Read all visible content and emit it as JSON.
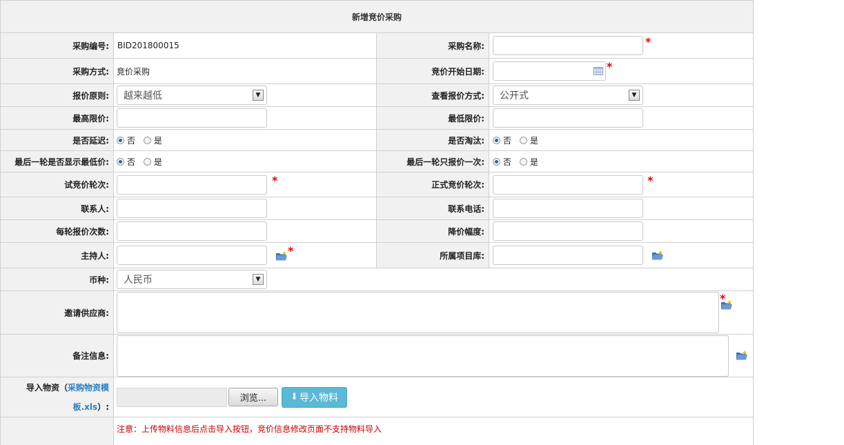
{
  "form": {
    "title": "新增竞价采购",
    "labels": {
      "proc_no": "采购编号:",
      "proc_name": "采购名称:",
      "proc_method": "采购方式:",
      "start_date": "竞价开始日期:",
      "quote_principle": "报价原则:",
      "view_quote_method": "查看报价方式:",
      "max_limit": "最高限价:",
      "min_limit": "最低限价:",
      "delay": "是否延迟:",
      "eliminate": "是否淘汰:",
      "show_lowest": "最后一轮是否显示最低价:",
      "quote_once": "最后一轮只报价一次:",
      "trial_rounds": "试竞价轮次:",
      "formal_rounds": "正式竞价轮次:",
      "contact": "联系人:",
      "phone": "联系电话:",
      "quotes_per_round": "每轮报价次数:",
      "price_drop": "降价幅度:",
      "host": "主持人:",
      "project_lib": "所属项目库:",
      "currency": "币种:",
      "suppliers": "邀请供应商:",
      "remarks": "备注信息:",
      "import_prefix": "导入物资（",
      "import_link": "采购物资模板.xls",
      "import_suffix": "）:",
      "import_link_line2": "板.xls",
      "import_suffix_line2": "）:"
    },
    "values": {
      "proc_no": "BID201800015",
      "proc_method": "竞价采购",
      "quote_principle": "越来越低",
      "view_quote_method": "公开式",
      "currency": "人民币"
    },
    "radio": {
      "no": "否",
      "yes": "是"
    },
    "required_mark": "*",
    "buttons": {
      "browse": "浏览...",
      "import": "导入物料"
    },
    "note": "注意：上传物料信息后点击导入按钮，竞价信息修改页面不支持物料导入",
    "import_link_line1": "采购物资模",
    "import_prefix_line1": "导入物资（"
  }
}
